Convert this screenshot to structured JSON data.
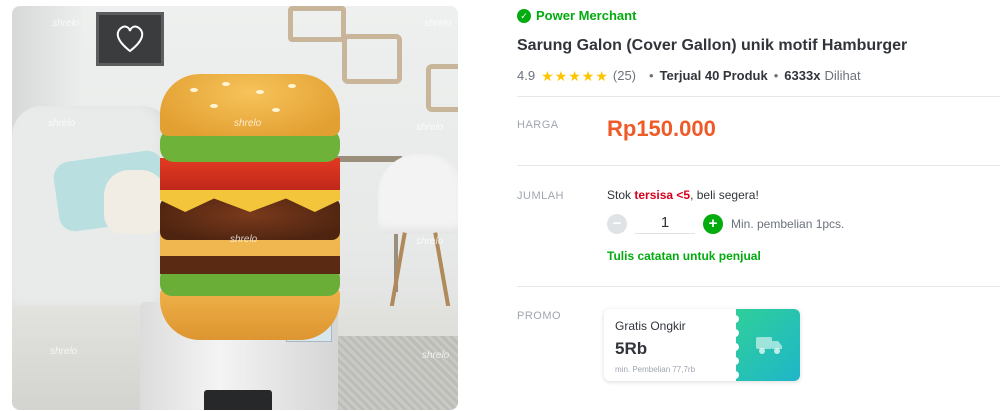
{
  "product_image": {
    "watermark": "shrelo"
  },
  "merchant": {
    "badge_label": "Power Merchant",
    "badge_color": "#03ac0e"
  },
  "product": {
    "title": "Sarung Galon (Cover Gallon) unik motif Hamburger",
    "rating": "4.9",
    "stars": 5,
    "review_count": "(25)",
    "sold": "Terjual 40 Produk",
    "views_count": "6333x",
    "views_label": "Dilihat"
  },
  "price_section": {
    "label": "HARGA",
    "price": "Rp150.000",
    "price_color": "#ef5a28"
  },
  "quantity_section": {
    "label": "JUMLAH",
    "stock_prefix": "Stok",
    "stock_warning": "tersisa <5",
    "stock_suffix": ", beli segera!",
    "quantity": "1",
    "min_purchase": "Min. pembelian 1pcs.",
    "note_link": "Tulis catatan untuk penjual"
  },
  "promo_section": {
    "label": "PROMO",
    "card_title": "Gratis Ongkir",
    "card_amount": "5Rb",
    "card_min": "min. Pembelian 77,7rb"
  }
}
